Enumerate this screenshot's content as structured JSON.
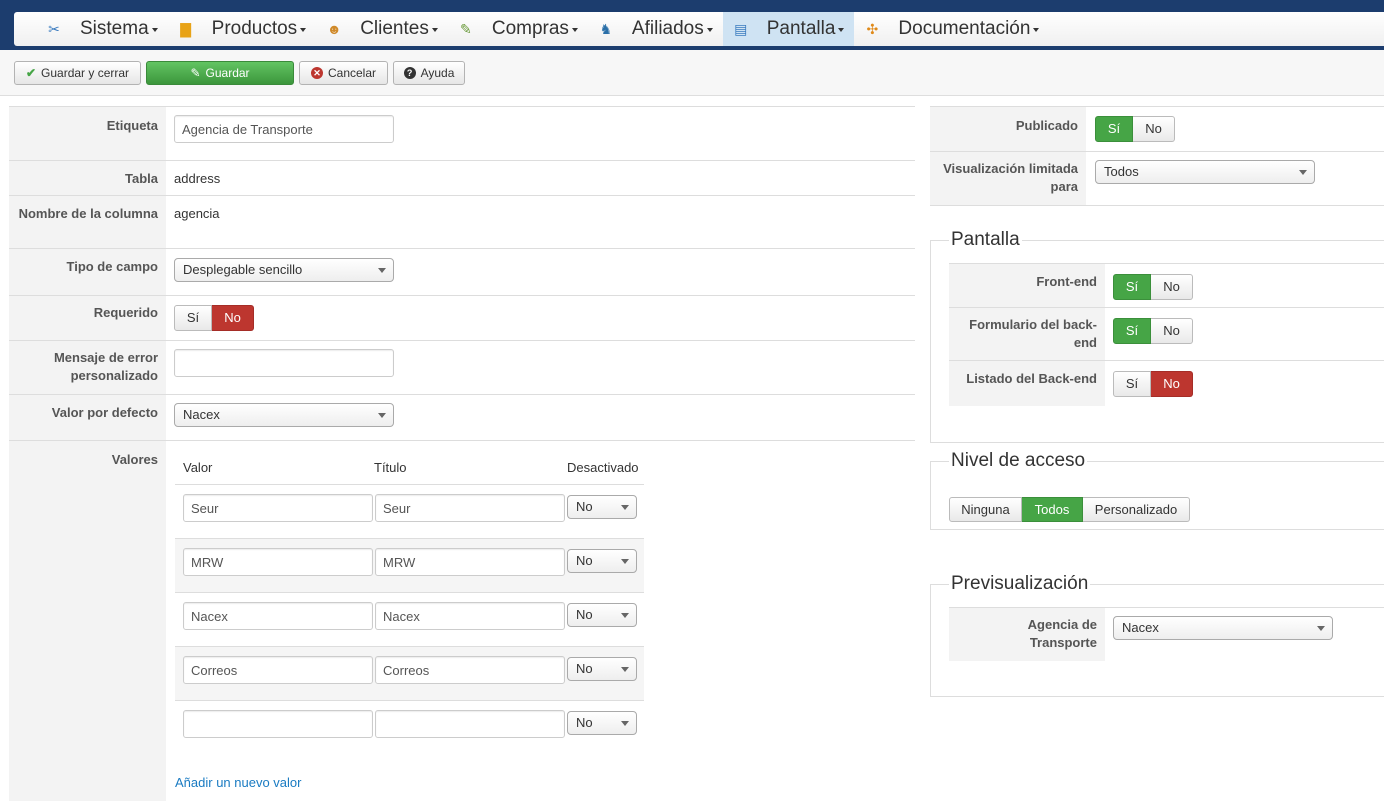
{
  "nav": {
    "items": [
      {
        "label": "Sistema",
        "icon": "tools-icon",
        "glyph": "✂",
        "color": "#3a7bbf"
      },
      {
        "label": "Productos",
        "icon": "box-icon",
        "glyph": "▇",
        "color": "#e8a317"
      },
      {
        "label": "Clientes",
        "icon": "users-icon",
        "glyph": "☻",
        "color": "#d08a2a"
      },
      {
        "label": "Compras",
        "icon": "receipt-icon",
        "glyph": "✎",
        "color": "#6a9a3a"
      },
      {
        "label": "Afiliados",
        "icon": "affiliate-icon",
        "glyph": "♞",
        "color": "#2a6fa8"
      },
      {
        "label": "Pantalla",
        "icon": "display-icon",
        "glyph": "▤",
        "color": "#3a7bbf"
      },
      {
        "label": "Documentación",
        "icon": "help-icon",
        "glyph": "✣",
        "color": "#e08a1a"
      }
    ],
    "active": "Pantalla"
  },
  "toolbar": {
    "save_close": "Guardar y cerrar",
    "save": "Guardar",
    "cancel": "Cancelar",
    "help": "Ayuda"
  },
  "form": {
    "etiqueta_label": "Etiqueta",
    "etiqueta_value": "Agencia de Transporte",
    "tabla_label": "Tabla",
    "tabla_value": "address",
    "columna_label": "Nombre de la columna",
    "columna_value": "agencia",
    "tipo_label": "Tipo de campo",
    "tipo_value": "Desplegable sencillo",
    "requerido_label": "Requerido",
    "requerido_yes": "Sí",
    "requerido_no": "No",
    "requerido_selected": "No",
    "mensaje_label": "Mensaje de error personalizado",
    "mensaje_value": "",
    "defecto_label": "Valor por defecto",
    "defecto_value": "Nacex",
    "valores_label": "Valores",
    "valores_headers": {
      "valor": "Valor",
      "titulo": "Título",
      "desactivado": "Desactivado"
    },
    "valores": [
      {
        "valor": "Seur",
        "titulo": "Seur",
        "desactivado": "No"
      },
      {
        "valor": "MRW",
        "titulo": "MRW",
        "desactivado": "No"
      },
      {
        "valor": "Nacex",
        "titulo": "Nacex",
        "desactivado": "No"
      },
      {
        "valor": "Correos",
        "titulo": "Correos",
        "desactivado": "No"
      },
      {
        "valor": "",
        "titulo": "",
        "desactivado": "No"
      }
    ],
    "add_value": "Añadir un nuevo valor"
  },
  "right": {
    "publicado_label": "Publicado",
    "publicado_yes": "Sí",
    "publicado_no": "No",
    "publicado_selected": "Sí",
    "visual_label": "Visualización limitada para",
    "visual_value": "Todos"
  },
  "pantalla": {
    "legend": "Pantalla",
    "frontend_label": "Front-end",
    "frontend_selected": "Sí",
    "backform_label": "Formulario del back-end",
    "backform_selected": "Sí",
    "backlist_label": "Listado del Back-end",
    "backlist_selected": "No",
    "yes": "Sí",
    "no": "No"
  },
  "acceso": {
    "legend": "Nivel de acceso",
    "options": [
      "Ninguna",
      "Todos",
      "Personalizado"
    ],
    "selected": "Todos"
  },
  "preview": {
    "legend": "Previsualización",
    "field_label": "Agencia de Transporte",
    "field_value": "Nacex"
  },
  "colors": {
    "header_bg": "#1c3d6e",
    "active_nav": "#cfe3f3",
    "green": "#46a546",
    "red": "#bd362f",
    "link": "#1a7bc2"
  }
}
